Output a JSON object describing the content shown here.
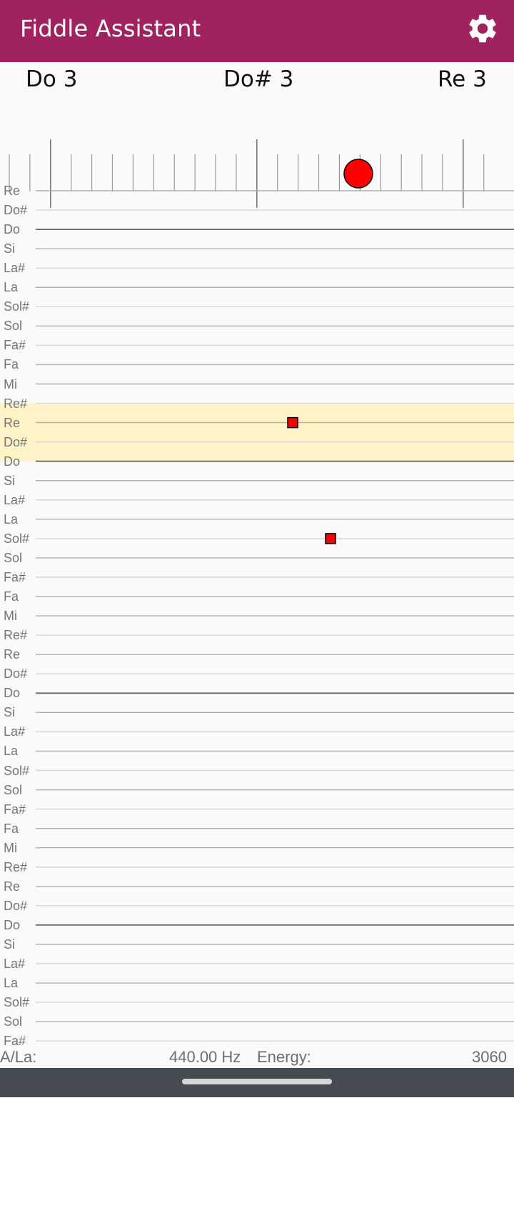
{
  "app_bar": {
    "title": "Fiddle Assistant",
    "settings_icon": "gear-icon",
    "color": "#a0225e"
  },
  "tuner": {
    "notes": {
      "left": "Do 3",
      "center": "Do# 3",
      "right": "Re 3"
    },
    "indicator_color": "#ff0000"
  },
  "staff": {
    "labels": [
      "Re",
      "Do#",
      "Do",
      "Si",
      "La#",
      "La",
      "Sol#",
      "Sol",
      "Fa#",
      "Fa",
      "Mi",
      "Re#",
      "Re",
      "Do#",
      "Do",
      "Si",
      "La#",
      "La",
      "Sol#",
      "Sol",
      "Fa#",
      "Fa",
      "Mi",
      "Re#",
      "Re",
      "Do#",
      "Do",
      "Si",
      "La#",
      "La",
      "Sol#",
      "Sol",
      "Fa#",
      "Fa",
      "Mi",
      "Re#",
      "Re",
      "Do#",
      "Do",
      "Si",
      "La#",
      "La",
      "Sol#",
      "Sol",
      "Fa#"
    ],
    "highlight_color": "#fff3c8",
    "marker_color": "#ff0000"
  },
  "footer": {
    "reference_label": "A/La:",
    "reference_value": "440.00 Hz",
    "energy_label": "Energy:",
    "energy_value": "3060"
  }
}
